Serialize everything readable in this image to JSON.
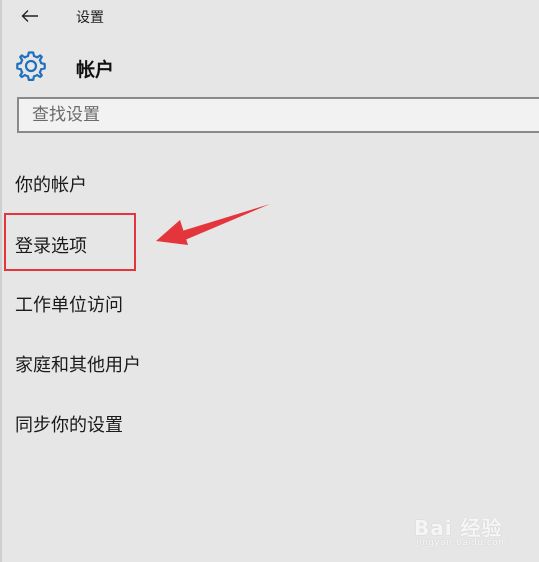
{
  "window": {
    "title": "设置"
  },
  "header": {
    "title": "帐户",
    "icon": "gear-icon"
  },
  "search": {
    "placeholder": "查找设置",
    "value": ""
  },
  "nav": {
    "items": [
      {
        "label": "你的帐户"
      },
      {
        "label": "登录选项"
      },
      {
        "label": "工作单位访问"
      },
      {
        "label": "家庭和其他用户"
      },
      {
        "label": "同步你的设置"
      }
    ]
  },
  "annotation": {
    "color": "#e5353c",
    "target": "登录选项"
  },
  "watermark": {
    "brand": "Bai 经验",
    "url": "jingyan.baidu.com"
  },
  "colors": {
    "accent": "#1f6fbf",
    "background": "#e6e6e6"
  }
}
